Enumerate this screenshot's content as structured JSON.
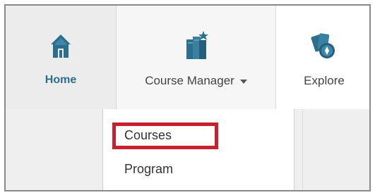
{
  "nav": {
    "home_label": "Home",
    "course_manager_label": "Course Manager",
    "explore_label": "Explore"
  },
  "dropdown": {
    "items": [
      "Courses",
      "Program"
    ]
  },
  "colors": {
    "accent": "#2c6e8c",
    "highlight": "#c8202e"
  },
  "icons": {
    "home": "home-icon",
    "course_manager": "book-stack-icon",
    "explore": "explore-icon",
    "dropdown": "chevron-down-icon"
  }
}
